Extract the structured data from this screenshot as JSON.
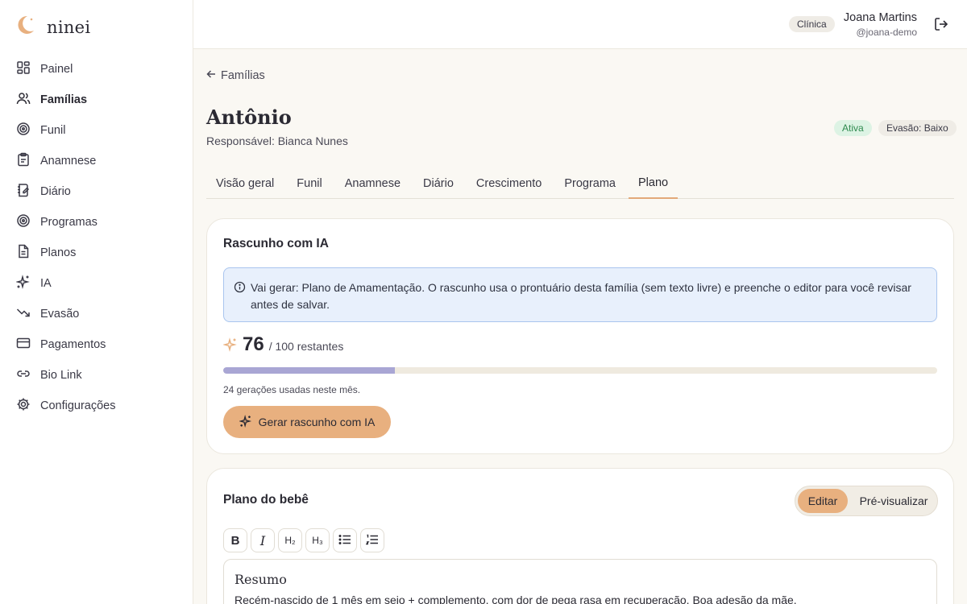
{
  "brand": {
    "name": "ninei"
  },
  "sidebar": {
    "items": [
      {
        "label": "Painel",
        "icon": "dashboard-icon"
      },
      {
        "label": "Famílias",
        "icon": "users-icon"
      },
      {
        "label": "Funil",
        "icon": "target-icon"
      },
      {
        "label": "Anamnese",
        "icon": "clipboard-icon"
      },
      {
        "label": "Diário",
        "icon": "notebook-icon"
      },
      {
        "label": "Programas",
        "icon": "target-icon"
      },
      {
        "label": "Planos",
        "icon": "file-text-icon"
      },
      {
        "label": "IA",
        "icon": "sparkles-icon"
      },
      {
        "label": "Evasão",
        "icon": "trending-down-icon"
      },
      {
        "label": "Pagamentos",
        "icon": "credit-card-icon"
      },
      {
        "label": "Bio Link",
        "icon": "link-icon"
      },
      {
        "label": "Configurações",
        "icon": "gear-icon"
      }
    ],
    "active": "Famílias"
  },
  "header": {
    "role": "Clínica",
    "user_name": "Joana Martins",
    "user_handle": "@joana-demo"
  },
  "main": {
    "back_label": "Famílias",
    "title": "Antônio",
    "subtitle": "Responsável: Bianca Nunes",
    "status_badge": "Ativa",
    "evasion_badge": "Evasão: Baixo",
    "tabs": [
      "Visão geral",
      "Funil",
      "Anamnese",
      "Diário",
      "Crescimento",
      "Programa",
      "Plano"
    ],
    "active_tab": "Plano"
  },
  "ai_card": {
    "title": "Rascunho com IA",
    "info": "Vai gerar: Plano de Amamentação. O rascunho usa o prontuário desta família (sem texto livre) e preenche o editor para você revisar antes de salvar.",
    "remaining": "76",
    "total_label": "/ 100 restantes",
    "used_fraction": 0.24,
    "usage_text": "24 gerações usadas neste mês.",
    "button_label": "Gerar rascunho com IA"
  },
  "plan_card": {
    "title": "Plano do bebê",
    "edit_label": "Editar",
    "preview_label": "Pré-visualizar",
    "toolbar": [
      "B",
      "I",
      "H₂",
      "H₃",
      "bullet-list-icon",
      "numbered-list-icon"
    ],
    "editor_heading": "Resumo",
    "editor_text": "Recém-nascido de 1 mês em seio + complemento, com dor de pega rasa em recuperação. Boa adesão da mãe."
  },
  "colors": {
    "accent": "#e8b07f",
    "progress": "#a9a6d4",
    "info_bg": "#e8f0fc",
    "active_badge_bg": "#ddf3e4"
  }
}
